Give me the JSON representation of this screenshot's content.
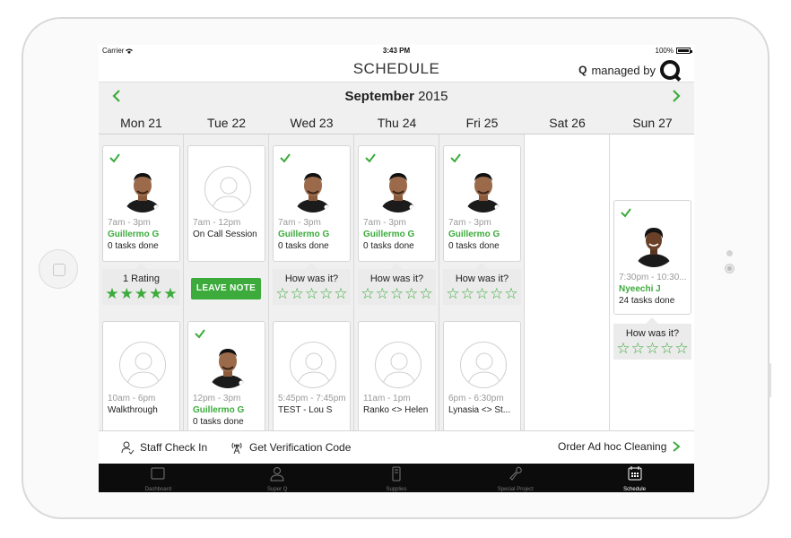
{
  "status_bar": {
    "carrier": "Carrier",
    "time": "3:43 PM",
    "battery": "100%"
  },
  "nav": {
    "title": "SCHEDULE",
    "managed_prefix": "Q",
    "managed_text": "managed by"
  },
  "month_bar": {
    "month": "September",
    "year": "2015"
  },
  "days": [
    "Mon 21",
    "Tue 22",
    "Wed 23",
    "Thu 24",
    "Fri 25",
    "Sat 26",
    "Sun 27"
  ],
  "cards": {
    "mon_1": {
      "time": "7am - 3pm",
      "name": "Guillermo G",
      "tasks": "0 tasks done",
      "rating_label": "1 Rating",
      "stars_filled": 5
    },
    "tue_1": {
      "time": "7am - 12pm",
      "name": "On Call Session",
      "button": "LEAVE NOTE"
    },
    "wed_1": {
      "time": "7am - 3pm",
      "name": "Guillermo G",
      "tasks": "0 tasks done",
      "rating_label": "How was it?",
      "stars_filled": 0
    },
    "thu_1": {
      "time": "7am - 3pm",
      "name": "Guillermo G",
      "tasks": "0 tasks done",
      "rating_label": "How was it?",
      "stars_filled": 0
    },
    "fri_1": {
      "time": "7am - 3pm",
      "name": "Guillermo G",
      "tasks": "0 tasks done",
      "rating_label": "How was it?",
      "stars_filled": 0
    },
    "sun_1": {
      "time": "7:30pm - 10:30...",
      "name": "Nyeechi J",
      "tasks": "24 tasks done",
      "rating_label": "How was it?",
      "stars_filled": 0
    },
    "mon_2": {
      "time": "10am - 6pm",
      "name": "Walkthrough"
    },
    "tue_2": {
      "time": "12pm - 3pm",
      "name": "Guillermo G",
      "tasks": "0 tasks done"
    },
    "wed_2": {
      "time": "5:45pm - 7:45pm",
      "name": "TEST - Lou S"
    },
    "thu_2": {
      "time": "11am - 1pm",
      "name": "Ranko <> Helen"
    },
    "fri_2": {
      "time": "6pm - 6:30pm",
      "name": "Lynasia <> St..."
    }
  },
  "actions": {
    "staff_check_in": "Staff Check In",
    "verification": "Get Verification Code",
    "order_cleaning": "Order Ad hoc Cleaning"
  },
  "tabs": [
    {
      "label": "Dashboard",
      "icon": "dashboard-icon"
    },
    {
      "label": "Super Q",
      "icon": "person-icon"
    },
    {
      "label": "Supplies",
      "icon": "supplies-icon"
    },
    {
      "label": "Special Project",
      "icon": "wrench-icon"
    },
    {
      "label": "Schedule",
      "icon": "calendar-icon"
    }
  ],
  "colors": {
    "accent_green": "#3cab3c",
    "tab_bar": "#0c0c0c",
    "header_bg": "#f0f0f0"
  }
}
